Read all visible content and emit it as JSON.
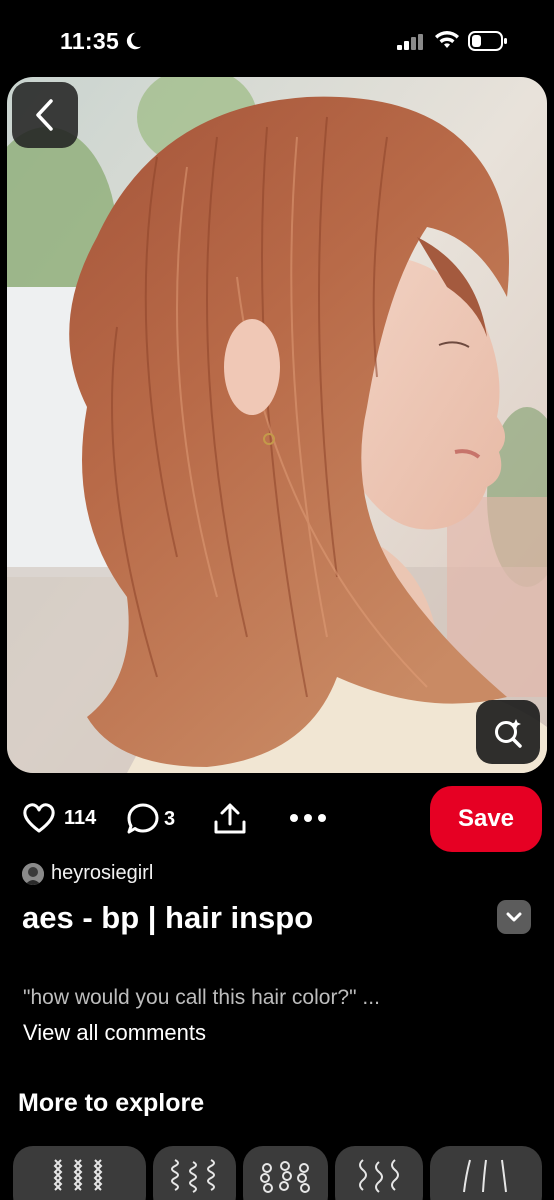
{
  "status_bar": {
    "time": "11:35"
  },
  "actions": {
    "likes": "114",
    "comments": "3",
    "save_label": "Save"
  },
  "pin": {
    "author": "heyrosiegirl",
    "title": "aes - bp | hair inspo",
    "comment_preview": "\"how would you call this hair color?\" ...",
    "view_all_comments": "View all comments"
  },
  "more_to_explore": {
    "heading": "More to explore",
    "cards": [
      "braid-pattern-icon",
      "curl-pattern-icon",
      "coil-pattern-icon",
      "wave-pattern-icon",
      "straight-pattern-icon"
    ]
  },
  "colors": {
    "save_red": "#e60023",
    "background": "#000000",
    "card_bg": "#3b3b3b"
  }
}
